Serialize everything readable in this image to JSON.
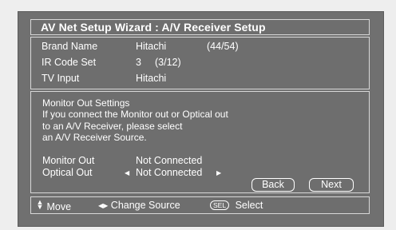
{
  "title": "AV Net Setup Wizard : A/V Receiver Setup",
  "info": {
    "brand_label": "Brand Name",
    "brand_value": "Hitachi",
    "brand_count": "(44/54)",
    "ir_label": "IR Code Set",
    "ir_value": "3",
    "ir_count": "(3/12)",
    "tv_label": "TV Input",
    "tv_value": "Hitachi"
  },
  "settings": {
    "heading": "Monitor Out Settings",
    "desc_lines": [
      "If you connect the Monitor out or Optical out",
      "to an A/V Receiver, please select",
      "an A/V Receiver Source."
    ],
    "monitor_label": "Monitor Out",
    "monitor_value": "Not Connected",
    "optical_label": "Optical Out",
    "optical_value": "Not Connected"
  },
  "buttons": {
    "back": "Back",
    "next": "Next"
  },
  "footer": {
    "move": "Move",
    "change_source": "Change Source",
    "sel_badge": "SEL",
    "select": "Select"
  },
  "colors": {
    "background": "#707070",
    "frame": "#eeeeee",
    "text": "#ffffff"
  }
}
